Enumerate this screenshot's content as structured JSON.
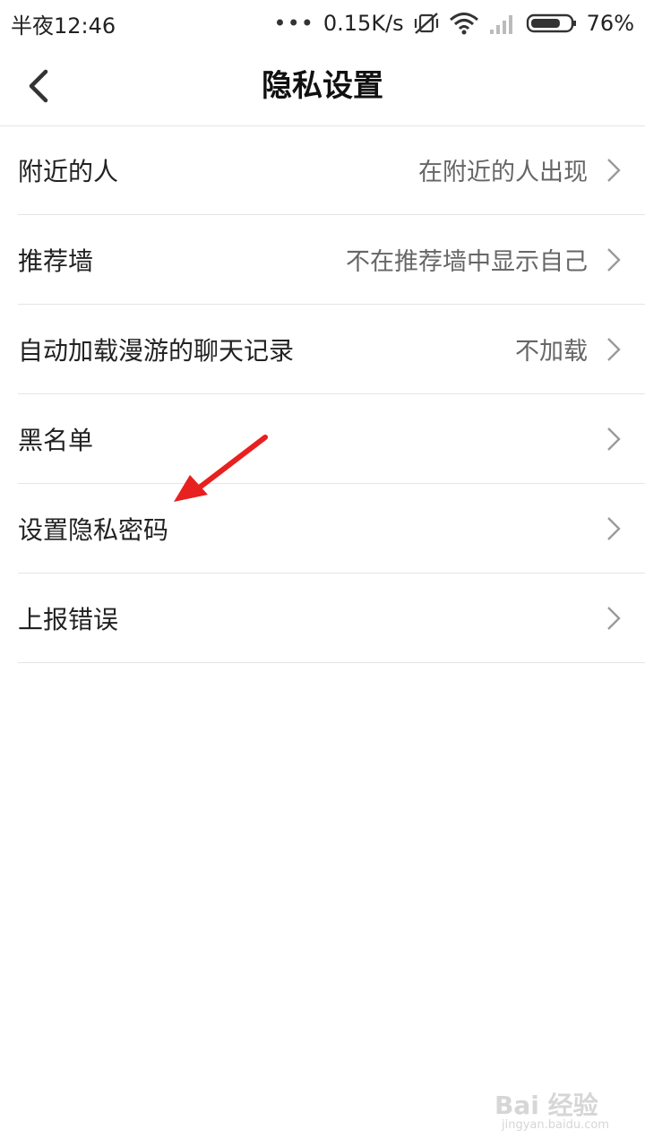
{
  "status_bar": {
    "time": "半夜12:46",
    "dots": "•••",
    "net_speed": "0.15K/s",
    "battery_percent": "76%",
    "battery_level": 0.76,
    "icons": [
      "mute-vibrate-icon",
      "wifi-icon",
      "signal-icon",
      "battery-icon"
    ]
  },
  "nav": {
    "title": "隐私设置",
    "back_icon": "chevron-left-icon"
  },
  "settings": {
    "items": [
      {
        "label": "附近的人",
        "value": "在附近的人出现"
      },
      {
        "label": "推荐墙",
        "value": "不在推荐墙中显示自己"
      },
      {
        "label": "自动加载漫游的聊天记录",
        "value": "不加载"
      },
      {
        "label": "黑名单",
        "value": ""
      },
      {
        "label": "设置隐私密码",
        "value": ""
      },
      {
        "label": "上报错误",
        "value": ""
      }
    ]
  },
  "annotation": {
    "color": "#e8201f",
    "points_to": "设置隐私密码"
  },
  "watermark": {
    "text": "Bai 经验",
    "sub": "jingyan.baidu.com"
  },
  "colors": {
    "chevron": "#9a9a9a",
    "divider": "#e5e5e5",
    "label": "#222222",
    "value": "#666666"
  }
}
